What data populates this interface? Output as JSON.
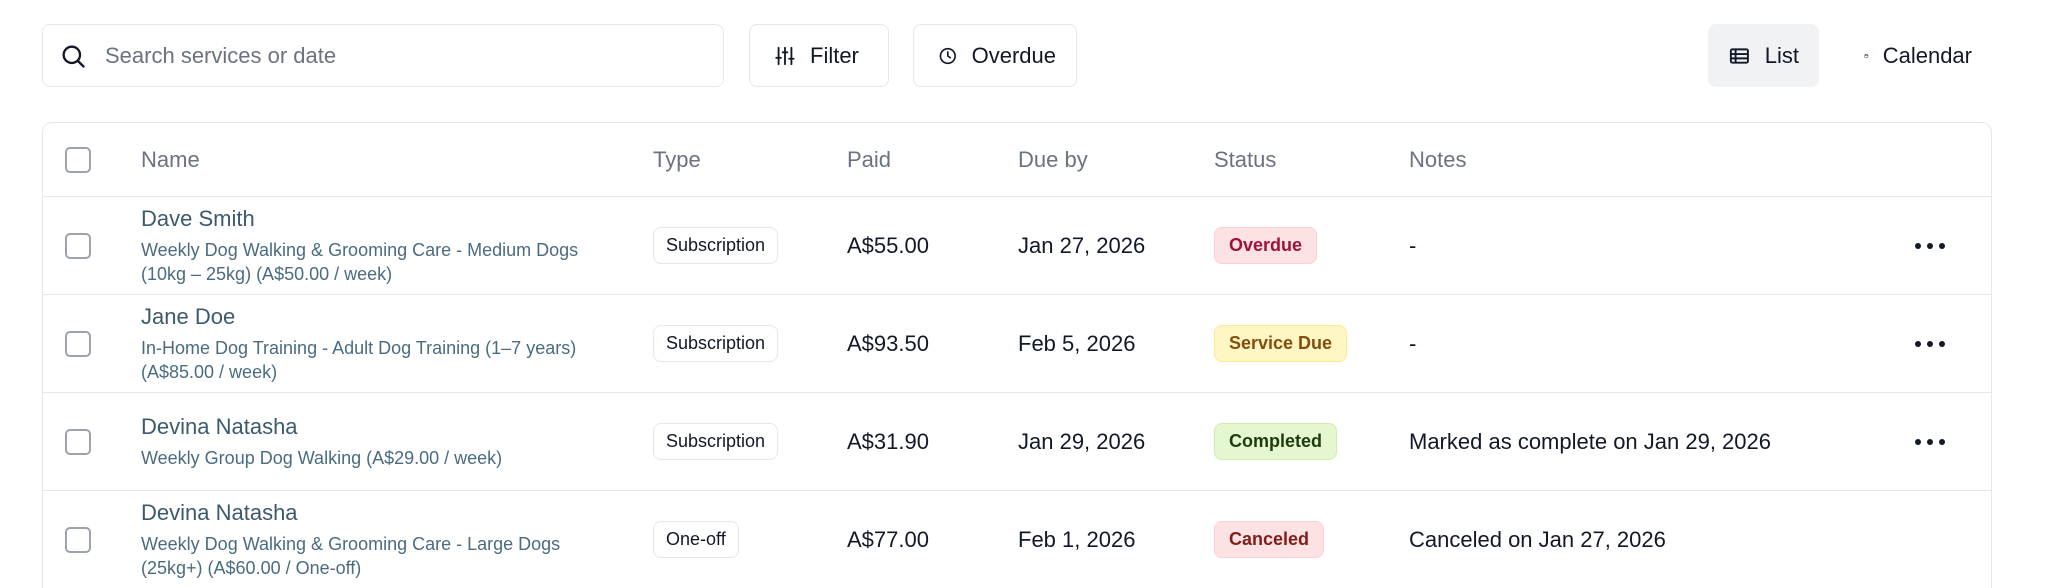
{
  "toolbar": {
    "search": {
      "placeholder": "Search services or date",
      "value": ""
    },
    "filter_label": "Filter",
    "overdue_label": "Overdue",
    "view_list_label": "List",
    "view_calendar_label": "Calendar"
  },
  "table": {
    "columns": {
      "name": "Name",
      "type": "Type",
      "paid": "Paid",
      "due_by": "Due by",
      "status": "Status",
      "notes": "Notes"
    },
    "rows": [
      {
        "name": "Dave Smith",
        "description": "Weekly Dog Walking & Grooming Care - Medium Dogs (10kg – 25kg) (A$50.00 / week)",
        "type": "Subscription",
        "paid": "A$55.00",
        "due_by": "Jan 27, 2026",
        "status": "Overdue",
        "notes": "-"
      },
      {
        "name": "Jane Doe",
        "description": "In-Home Dog Training - Adult Dog Training (1–7 years) (A$85.00 / week)",
        "type": "Subscription",
        "paid": "A$93.50",
        "due_by": "Feb 5, 2026",
        "status": "Service Due",
        "notes": "-"
      },
      {
        "name": "Devina Natasha",
        "description": "Weekly Group Dog Walking (A$29.00 / week)",
        "type": "Subscription",
        "paid": "A$31.90",
        "due_by": "Jan 29, 2026",
        "status": "Completed",
        "notes": "Marked as complete on Jan 29, 2026"
      },
      {
        "name": "Devina Natasha",
        "description": "Weekly Dog Walking & Grooming Care - Large Dogs (25kg+) (A$60.00 / One-off)",
        "type": "One-off",
        "paid": "A$77.00",
        "due_by": "Feb 1, 2026",
        "status": "Canceled",
        "notes": "Canceled on Jan 27, 2026"
      }
    ]
  },
  "colors": {
    "overdue": "#9f1239",
    "service_due": "#854d0e",
    "completed": "#1f3b0e",
    "canceled": "#7f1d1d",
    "name_text": "#3c5a6e"
  },
  "icons": {
    "search": "search-icon",
    "filter": "sliders-icon",
    "overdue": "clock-icon",
    "list": "list-icon",
    "calendar": "calendar-icon",
    "row_actions": "more-horizontal-icon"
  }
}
